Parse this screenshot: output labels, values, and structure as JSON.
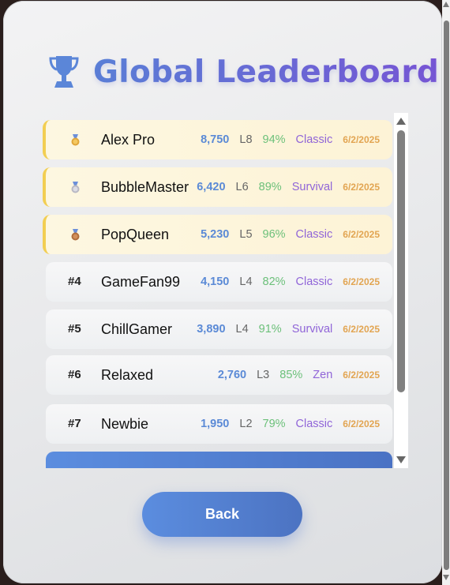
{
  "title": "Global Leaderboard",
  "icons": {
    "title": "trophy-icon",
    "medals": [
      "gold-medal-icon",
      "silver-medal-icon",
      "bronze-medal-icon"
    ]
  },
  "colors": {
    "accent": "#5b8ddf",
    "gold": "#f2ce52",
    "score": "#5b8ad6",
    "accuracy": "#6cc07a",
    "mode": "#9065d8",
    "date": "#e2a552"
  },
  "entries": [
    {
      "rank": "",
      "name": "Alex Pro",
      "score": "8,750",
      "level": "L8",
      "accuracy": "94%",
      "mode": "Classic",
      "date": "6/2/2025"
    },
    {
      "rank": "",
      "name": "BubbleMaster",
      "score": "6,420",
      "level": "L6",
      "accuracy": "89%",
      "mode": "Survival",
      "date": "6/2/2025"
    },
    {
      "rank": "",
      "name": "PopQueen",
      "score": "5,230",
      "level": "L5",
      "accuracy": "96%",
      "mode": "Classic",
      "date": "6/2/2025"
    },
    {
      "rank": "#4",
      "name": "GameFan99",
      "score": "4,150",
      "level": "L4",
      "accuracy": "82%",
      "mode": "Classic",
      "date": "6/2/2025"
    },
    {
      "rank": "#5",
      "name": "ChillGamer",
      "score": "3,890",
      "level": "L4",
      "accuracy": "91%",
      "mode": "Survival",
      "date": "6/2/2025"
    },
    {
      "rank": "#6",
      "name": "Relaxed",
      "score": "2,760",
      "level": "L3",
      "accuracy": "85%",
      "mode": "Zen",
      "date": "6/2/2025"
    },
    {
      "rank": "#7",
      "name": "Newbie",
      "score": "1,950",
      "level": "L2",
      "accuracy": "79%",
      "mode": "Classic",
      "date": "6/2/2025"
    }
  ],
  "back_label": "Back"
}
